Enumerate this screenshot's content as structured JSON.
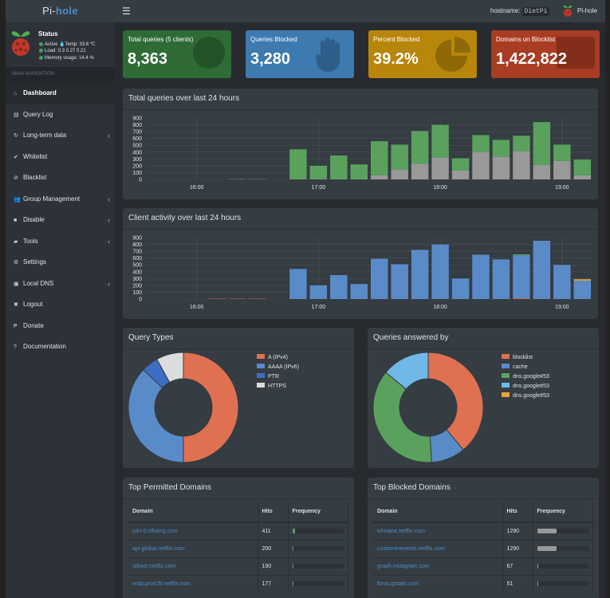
{
  "header": {
    "logo_pi": "Pi-",
    "logo_hole": "hole",
    "hostname_label": "hostname:",
    "hostname": "DietPi",
    "user_name": "Pi-hole"
  },
  "status": {
    "title": "Status",
    "active": "Active",
    "temp": "Temp: 33.6 ℃",
    "load_label": "Load:",
    "load": "0.3  0.27  0.21",
    "memory_label": "Memory usage:",
    "memory": "14.4 %"
  },
  "sidebar": {
    "section_label": "MAIN NAVIGATION",
    "items": [
      {
        "label": "Dashboard",
        "icon": "home-icon",
        "active": true,
        "chevron": false
      },
      {
        "label": "Query Log",
        "icon": "file-icon",
        "active": false,
        "chevron": false
      },
      {
        "label": "Long-term data",
        "icon": "history-icon",
        "active": false,
        "chevron": true
      },
      {
        "label": "Whitelist",
        "icon": "check-circle-icon",
        "active": false,
        "chevron": false
      },
      {
        "label": "Blacklist",
        "icon": "ban-icon",
        "active": false,
        "chevron": false
      },
      {
        "label": "Group Management",
        "icon": "users-icon",
        "active": false,
        "chevron": true
      },
      {
        "label": "Disable",
        "icon": "stop-icon",
        "active": false,
        "chevron": true
      },
      {
        "label": "Tools",
        "icon": "folder-icon",
        "active": false,
        "chevron": true
      },
      {
        "label": "Settings",
        "icon": "gears-icon",
        "active": false,
        "chevron": false
      },
      {
        "label": "Local DNS",
        "icon": "address-book-icon",
        "active": false,
        "chevron": true
      },
      {
        "label": "Logout",
        "icon": "user-times-icon",
        "active": false,
        "chevron": false
      },
      {
        "label": "Donate",
        "icon": "paypal-icon",
        "active": false,
        "chevron": false
      },
      {
        "label": "Documentation",
        "icon": "question-circle-icon",
        "active": false,
        "chevron": false
      }
    ]
  },
  "stats": [
    {
      "label": "Total queries (5 clients)",
      "value": "8,363",
      "color": "#2e6b35",
      "icon": "globe-icon"
    },
    {
      "label": "Queries Blocked",
      "value": "3,280",
      "color": "#3d7ab0",
      "icon": "hand-icon"
    },
    {
      "label": "Percent Blocked",
      "value": "39.2%",
      "color": "#b8860b",
      "icon": "pie-chart-icon"
    },
    {
      "label": "Domains on Blocklist",
      "value": "1,422,822",
      "color": "#a93c22",
      "icon": "list-icon"
    }
  ],
  "chart_data": [
    {
      "type": "bar",
      "title": "Total queries over last 24 hours",
      "x_tick_labels": [
        "16:00",
        "17:00",
        "18:00",
        "19:00"
      ],
      "y_ticks": [
        0,
        100,
        200,
        300,
        400,
        500,
        600,
        700,
        800,
        900
      ],
      "ylim": [
        0,
        900
      ],
      "grid": true,
      "series": [
        {
          "color": "#999999",
          "values": [
            0,
            0,
            0,
            0,
            0,
            0,
            0,
            0,
            0,
            0,
            0,
            60,
            140,
            230,
            320,
            130,
            400,
            330,
            410,
            210,
            270,
            60
          ]
        },
        {
          "color": "#5aa15e",
          "values": [
            0,
            0,
            0,
            0,
            5,
            5,
            0,
            440,
            200,
            350,
            220,
            500,
            370,
            480,
            480,
            180,
            250,
            250,
            230,
            630,
            240,
            230
          ]
        }
      ]
    },
    {
      "type": "bar",
      "title": "Client activity over last 24 hours",
      "x_tick_labels": [
        "16:00",
        "17:00",
        "18:00",
        "19:00"
      ],
      "y_ticks": [
        0,
        100,
        200,
        300,
        400,
        500,
        600,
        700,
        800,
        900
      ],
      "ylim": [
        0,
        900
      ],
      "grid": true,
      "series": [
        {
          "color": "#e07150",
          "values": [
            0,
            0,
            0,
            5,
            5,
            5,
            0,
            0,
            0,
            0,
            0,
            0,
            0,
            0,
            0,
            0,
            0,
            0,
            10,
            0,
            0,
            0
          ]
        },
        {
          "color": "#5a8bc9",
          "values": [
            0,
            0,
            0,
            0,
            0,
            0,
            0,
            440,
            200,
            350,
            220,
            590,
            510,
            720,
            800,
            300,
            650,
            580,
            630,
            840,
            500,
            270
          ]
        },
        {
          "color": "#5aa15e",
          "values": [
            0,
            0,
            0,
            0,
            0,
            0,
            0,
            0,
            0,
            0,
            0,
            0,
            0,
            0,
            0,
            0,
            0,
            0,
            15,
            0,
            0,
            0
          ]
        },
        {
          "color": "#6fb8e8",
          "values": [
            0,
            0,
            0,
            0,
            0,
            0,
            0,
            0,
            0,
            0,
            0,
            0,
            0,
            0,
            0,
            0,
            0,
            0,
            0,
            10,
            0,
            0
          ]
        },
        {
          "color": "#e8a33c",
          "values": [
            0,
            0,
            0,
            0,
            0,
            0,
            0,
            0,
            0,
            0,
            0,
            0,
            0,
            0,
            0,
            0,
            0,
            0,
            0,
            0,
            0,
            20
          ]
        }
      ]
    },
    {
      "type": "pie",
      "title": "Query Types",
      "labels": [
        "A (IPv4)",
        "AAAA (IPv6)",
        "PTR",
        "HTTPS"
      ],
      "values": [
        50,
        37,
        5,
        8
      ],
      "colors": [
        "#e07150",
        "#5a8bc9",
        "#3d6ec4",
        "#dcdcdc"
      ]
    },
    {
      "type": "pie",
      "title": "Queries answered by",
      "labels": [
        "blocklist",
        "cache",
        "dns.google#53",
        "dns.google#53",
        "dns.google#53"
      ],
      "values": [
        39,
        10,
        37,
        14,
        0
      ],
      "colors": [
        "#e07150",
        "#5a8bc9",
        "#5aa15e",
        "#6fb8e8",
        "#e8a33c"
      ]
    }
  ],
  "tables": {
    "permitted": {
      "title": "Top Permitted Domains",
      "headers": [
        "Domain",
        "Hits",
        "Frequency"
      ],
      "rows": [
        {
          "domain": "cdn-0.nflximg.com",
          "hits": "411",
          "freq": 0.05,
          "color": "#5aa15e"
        },
        {
          "domain": "api-global.netflix.com",
          "hits": "200",
          "freq": 0.025,
          "color": "#5aa15e"
        },
        {
          "domain": "uiboot.netflix.com",
          "hits": "190",
          "freq": 0.023,
          "color": "#5aa15e"
        },
        {
          "domain": "nrdp.prod.ftl.netflix.com",
          "hits": "177",
          "freq": 0.021,
          "color": "#5aa15e"
        }
      ]
    },
    "blocked": {
      "title": "Top Blocked Domains",
      "headers": [
        "Domain",
        "Hits",
        "Frequency"
      ],
      "rows": [
        {
          "domain": "ichnaea.netflix.com",
          "hits": "1290",
          "freq": 0.39,
          "color": "#999999"
        },
        {
          "domain": "customerevents.netflix.com",
          "hits": "1290",
          "freq": 0.39,
          "color": "#999999"
        },
        {
          "domain": "graph.instagram.com",
          "hits": "67",
          "freq": 0.02,
          "color": "#999999"
        },
        {
          "domain": "fonts.gstatic.com",
          "hits": "51",
          "freq": 0.016,
          "color": "#999999"
        }
      ]
    }
  }
}
